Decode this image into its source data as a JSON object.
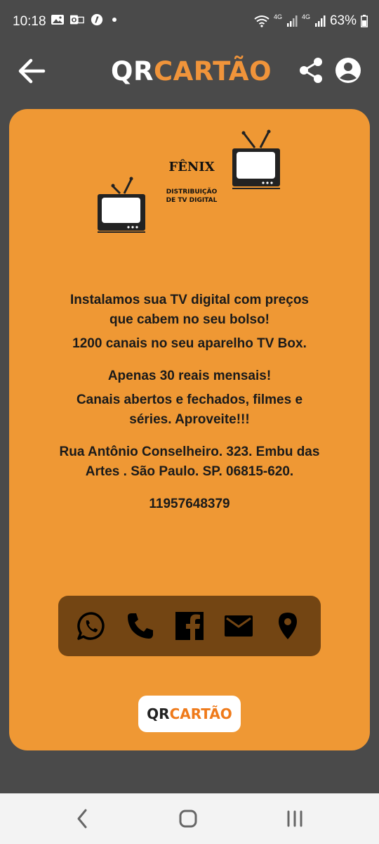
{
  "status_bar": {
    "time": "10:18",
    "battery": "63%",
    "signal_label_1": "4G",
    "signal_label_2": "4G",
    "icons": [
      "image-icon",
      "outlook-icon",
      "app-icon",
      "wifi-icon",
      "signal-icon",
      "signal-icon",
      "battery-icon"
    ]
  },
  "app_bar": {
    "brand_prefix": "QR",
    "brand_suffix": "CARTÃO",
    "icons": [
      "back-arrow-icon",
      "share-icon",
      "account-icon"
    ]
  },
  "card": {
    "logo": {
      "title": "FÊNIX",
      "subtitle_line1": "DISTRIBUIÇÃO",
      "subtitle_line2": "DE TV DIGITAL"
    },
    "description": {
      "line1": "Instalamos sua TV digital com preços",
      "line2": "que cabem no seu bolso!",
      "line3": "1200 canais no seu  aparelho TV Box.",
      "line4": "Apenas 30 reais mensais!",
      "line5": "Canais abertos e fechados, filmes e",
      "line6": "séries. Aproveite!!!",
      "line7": "Rua Antônio Conselheiro. 323. Embu das",
      "line8": "Artes . São Paulo. SP. 06815-620.",
      "line9": "11957648379"
    },
    "contact_icons": [
      "whatsapp-icon",
      "phone-icon",
      "facebook-icon",
      "email-icon",
      "location-pin-icon"
    ],
    "footer_badge": {
      "prefix": "QR",
      "suffix": "CARTÃO"
    }
  },
  "nav_bar": {
    "icons": [
      "nav-back-icon",
      "nav-home-icon",
      "nav-recent-apps-icon"
    ]
  },
  "colors": {
    "background": "#4a4a4a",
    "card": "#ef9834",
    "contact_bar": "#734513",
    "brand_orange": "#f0943a"
  }
}
